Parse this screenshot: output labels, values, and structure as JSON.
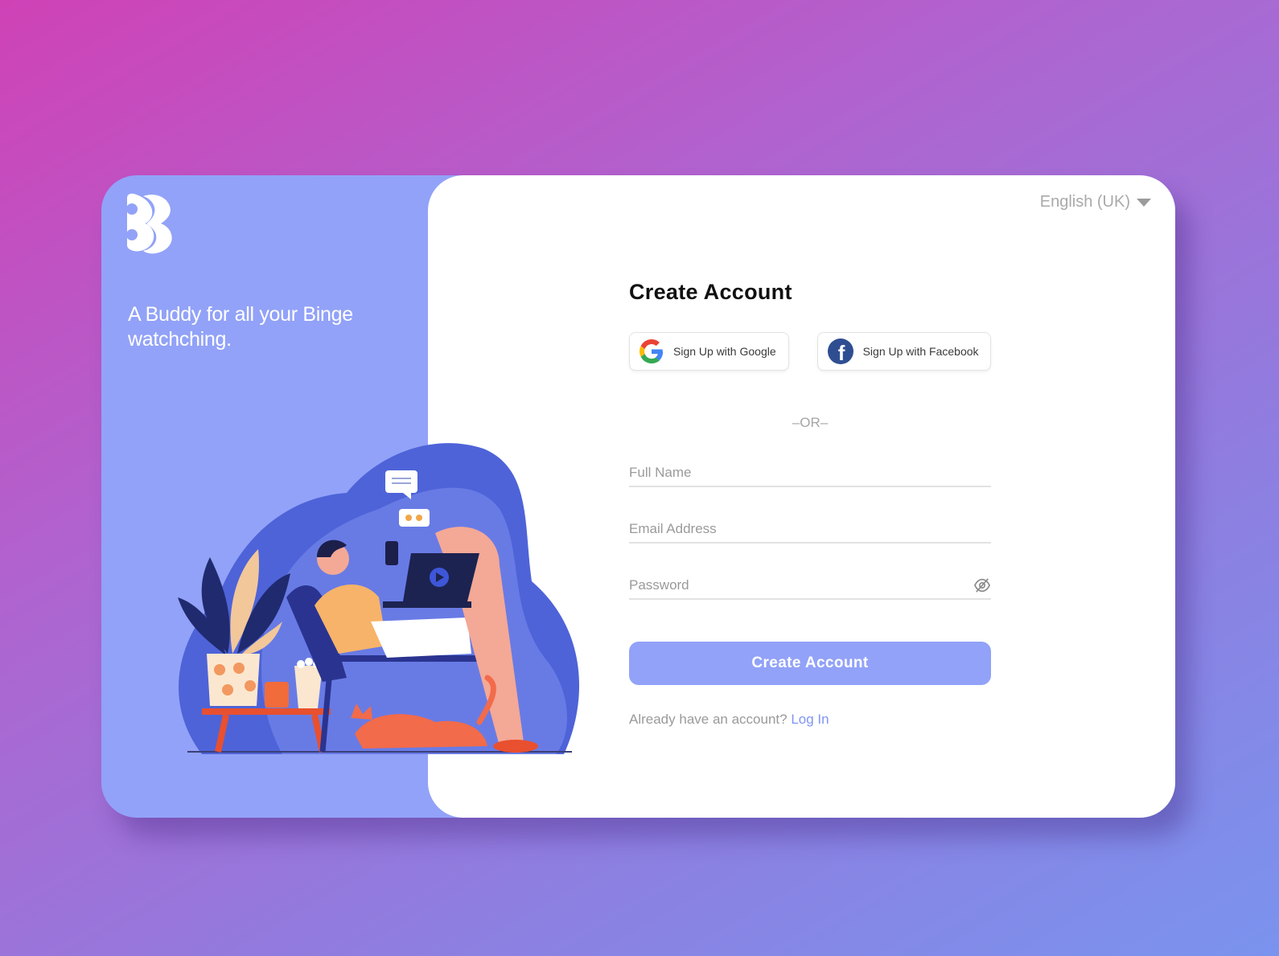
{
  "brand": {
    "logo_icon": "bb-logo-icon",
    "tagline": "A Buddy for all your Binge watchching.",
    "accent_color": "#92a2f8"
  },
  "language": {
    "selected": "English (UK)",
    "icon": "chevron-down-icon"
  },
  "form": {
    "title": "Create Account",
    "google_label": "Sign Up with Google",
    "google_icon": "google-icon",
    "facebook_label": "Sign Up with Facebook",
    "facebook_icon": "facebook-icon",
    "or_text": "–OR–",
    "full_name_placeholder": "Full Name",
    "email_placeholder": "Email Address",
    "password_placeholder": "Password",
    "password_toggle_icon": "eye-off-icon",
    "submit_label": "Create Account",
    "footer_text": "Already have an account? ",
    "login_link": "Log In"
  },
  "illustration": {
    "icon": "binge-watching-illustration"
  }
}
